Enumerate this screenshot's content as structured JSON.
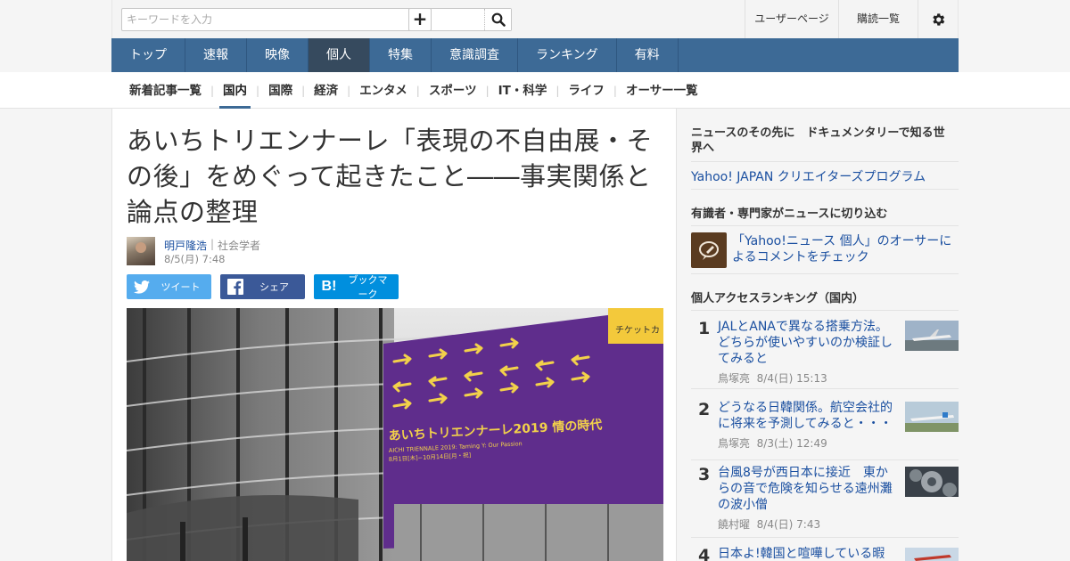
{
  "search": {
    "placeholder": "キーワードを入力"
  },
  "top_links": {
    "user_page": "ユーザーページ",
    "subscriptions": "購読一覧",
    "add": "+"
  },
  "main_nav": [
    {
      "label": "トップ"
    },
    {
      "label": "速報"
    },
    {
      "label": "映像"
    },
    {
      "label": "個人",
      "active": true
    },
    {
      "label": "特集"
    },
    {
      "label": "意識調査"
    },
    {
      "label": "ランキング"
    },
    {
      "label": "有料"
    }
  ],
  "sub_nav": [
    {
      "label": "新着記事一覧"
    },
    {
      "label": "国内",
      "active": true
    },
    {
      "label": "国際"
    },
    {
      "label": "経済"
    },
    {
      "label": "エンタメ"
    },
    {
      "label": "スポーツ"
    },
    {
      "label": "IT・科学"
    },
    {
      "label": "ライフ"
    },
    {
      "label": "オーサー一覧"
    }
  ],
  "article": {
    "title": "あいちトリエンナーレ「表現の不自由展・その後」をめぐって起きたこと――事実関係と論点の整理",
    "author": "明戸隆浩",
    "author_sep": "|",
    "author_role": "社会学者",
    "date": "8/5(月) 7:48",
    "share": {
      "twitter": "ツイート",
      "facebook": "シェア",
      "hatena": "ブックマーク"
    },
    "photo_banner_text": "あいちトリエンナーレ2019 情の時代",
    "photo_banner_en": "AICHI TRIENNALE 2019: Taming Y: Our Passion",
    "photo_banner_dates": "8月1日[木]−10月14日[月・祝]",
    "photo_sign": "チケットカ"
  },
  "sidebar": {
    "doc_heading": "ニュースのその先に　ドキュメンタリーで知る世界へ",
    "doc_link": "Yahoo! JAPAN クリエイターズプログラム",
    "expert_heading": "有識者・専門家がニュースに切り込む",
    "expert_link": "「Yahoo!ニュース 個人」のオーサーによるコメントをチェック",
    "ranking_heading": "個人アクセスランキング（国内）",
    "ranking": [
      {
        "rank": "1",
        "title": "JALとANAで異なる搭乗方法。どちらが使いやすいのか検証してみると",
        "author": "鳥塚亮",
        "date": "8/4(日) 15:13"
      },
      {
        "rank": "2",
        "title": "どうなる日韓関係。航空会社的に将来を予測してみると・・・",
        "author": "鳥塚亮",
        "date": "8/3(土) 12:49"
      },
      {
        "rank": "3",
        "title": "台風8号が西日本に接近　東からの音で危険を知らせる遠州灘の波小僧",
        "author": "饒村曜",
        "date": "8/4(日) 7:43"
      },
      {
        "rank": "4",
        "title": "日本よ!韓国と喧嘩している暇は",
        "author": "",
        "date": ""
      }
    ]
  }
}
